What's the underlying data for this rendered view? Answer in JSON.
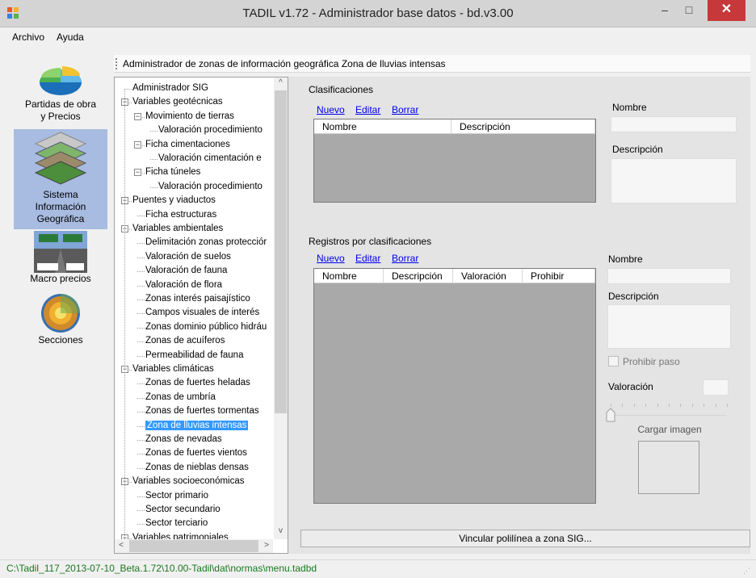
{
  "window": {
    "title": "TADIL v1.72 - Administrador base datos - bd.v3.00",
    "controls": {
      "minimize": "–",
      "maximize": "□",
      "close": "✕"
    }
  },
  "menu": {
    "items": [
      "Archivo",
      "Ayuda"
    ]
  },
  "nav": {
    "items": [
      {
        "label_lines": [
          "Partidas de obra",
          "y Precios"
        ],
        "icon": "pie-chart-icon"
      },
      {
        "label_lines": [
          "Sistema",
          "Información",
          "Geográfica"
        ],
        "icon": "gis-layers-icon",
        "selected": true
      },
      {
        "label_lines": [
          "Macro precios"
        ],
        "icon": "highway-icon"
      },
      {
        "label_lines": [
          "Secciones"
        ],
        "icon": "earth-section-icon"
      }
    ]
  },
  "header": {
    "text": "Administrador de zonas de información geográfica  Zona de lluvias intensas"
  },
  "tree": {
    "items": [
      {
        "text": "Administrador SIG",
        "level": 0,
        "expander": ""
      },
      {
        "text": "Variables geotécnicas",
        "level": 0,
        "expander": "−"
      },
      {
        "text": "Movimiento de tierras",
        "level": 1,
        "expander": "−"
      },
      {
        "text": "Valoración procedimiento",
        "level": 2,
        "expander": ""
      },
      {
        "text": "Ficha cimentaciones",
        "level": 1,
        "expander": "−"
      },
      {
        "text": "Valoración cimentación e",
        "level": 2,
        "expander": ""
      },
      {
        "text": "Ficha túneles",
        "level": 1,
        "expander": "−"
      },
      {
        "text": "Valoración procedimiento",
        "level": 2,
        "expander": ""
      },
      {
        "text": "Puentes y viaductos",
        "level": 0,
        "expander": "−"
      },
      {
        "text": "Ficha estructuras",
        "level": 1,
        "expander": ""
      },
      {
        "text": "Variables ambientales",
        "level": 0,
        "expander": "−"
      },
      {
        "text": "Delimitación zonas protecciór",
        "level": 1,
        "expander": ""
      },
      {
        "text": "Valoración de suelos",
        "level": 1,
        "expander": ""
      },
      {
        "text": "Valoración de fauna",
        "level": 1,
        "expander": ""
      },
      {
        "text": "Valoración de flora",
        "level": 1,
        "expander": ""
      },
      {
        "text": "Zonas interés paisajístico",
        "level": 1,
        "expander": ""
      },
      {
        "text": "Campos visuales de interés",
        "level": 1,
        "expander": ""
      },
      {
        "text": "Zonas dominio público hidráu",
        "level": 1,
        "expander": ""
      },
      {
        "text": "Zonas de acuíferos",
        "level": 1,
        "expander": ""
      },
      {
        "text": "Permeabilidad de fauna",
        "level": 1,
        "expander": ""
      },
      {
        "text": "Variables climáticas",
        "level": 0,
        "expander": "−"
      },
      {
        "text": "Zonas de fuertes heladas",
        "level": 1,
        "expander": ""
      },
      {
        "text": "Zonas de umbría",
        "level": 1,
        "expander": ""
      },
      {
        "text": "Zonas de fuertes tormentas",
        "level": 1,
        "expander": ""
      },
      {
        "text": "Zona de lluvias intensas",
        "level": 1,
        "expander": "",
        "selected": true
      },
      {
        "text": "Zonas de nevadas",
        "level": 1,
        "expander": ""
      },
      {
        "text": "Zonas de fuertes vientos",
        "level": 1,
        "expander": ""
      },
      {
        "text": "Zonas de nieblas densas",
        "level": 1,
        "expander": ""
      },
      {
        "text": "Variables socioeconómicas",
        "level": 0,
        "expander": "−"
      },
      {
        "text": "Sector primario",
        "level": 1,
        "expander": ""
      },
      {
        "text": "Sector secundario",
        "level": 1,
        "expander": ""
      },
      {
        "text": "Sector terciario",
        "level": 1,
        "expander": ""
      },
      {
        "text": "Variables patrimoniales",
        "level": 0,
        "expander": "−"
      }
    ],
    "scroll_up": "^",
    "scroll_down": "v",
    "scroll_left": "<",
    "scroll_right": ">"
  },
  "classifications": {
    "title": "Clasificaciones",
    "actions": {
      "new": "Nuevo",
      "edit": "Editar",
      "delete": "Borrar"
    },
    "columns": [
      "Nombre",
      "Descripción"
    ],
    "name_label": "Nombre",
    "description_label": "Descripción",
    "name_value": "",
    "description_value": ""
  },
  "records": {
    "title": "Registros por clasificaciones",
    "actions": {
      "new": "Nuevo",
      "edit": "Editar",
      "delete": "Borrar"
    },
    "columns": [
      "Nombre",
      "Descripción",
      "Valoración",
      "Prohibir"
    ],
    "name_label": "Nombre",
    "description_label": "Descripción",
    "prohibit_label": "Prohibir paso",
    "prohibit_checked": false,
    "valuation_label": "Valoración",
    "valuation_value": "",
    "slider_level": 0,
    "load_image_label": "Cargar imagen"
  },
  "link_button": "Vincular polilínea a zona SIG...",
  "status": {
    "path": "C:\\Tadil_117_2013-07-10_Beta.1.72\\10.00-Tadil\\dat\\normas\\menu.tadbd"
  }
}
